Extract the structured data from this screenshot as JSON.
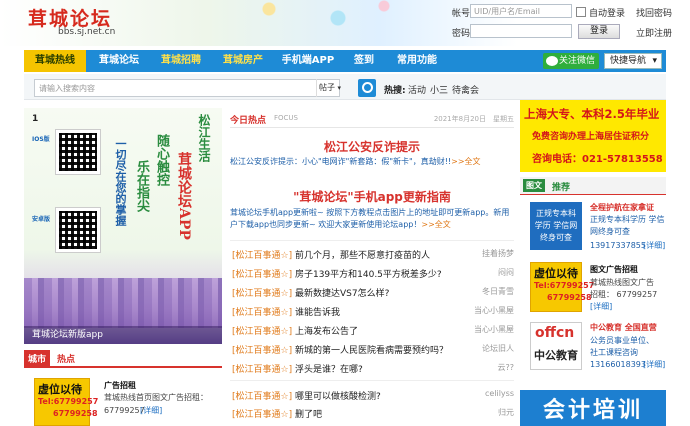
{
  "header": {
    "logo_text": "茸城论坛",
    "logo_url": "bbs.sj.net.cn",
    "login": {
      "account_label": "帐号",
      "account_placeholder": "UID/用户名/Email",
      "auto_login": "自动登录",
      "retrieve_password": "找回密码",
      "password_label": "密码",
      "login_button": "登录",
      "register": "立即注册"
    }
  },
  "nav": {
    "items": [
      "茸城热线",
      "茸城论坛",
      "茸城招聘",
      "茸城房产",
      "手机端APP",
      "签到",
      "常用功能"
    ],
    "wechat": "关注微信",
    "quicknav": "快捷导航"
  },
  "search": {
    "placeholder": "请输入搜索内容",
    "type": "帖子",
    "hot_label": "热搜:",
    "hot_links": [
      "活动",
      "小三",
      "待禽会"
    ]
  },
  "poster": {
    "number": "1",
    "ios_label": "IOS版",
    "android_label": "安卓版",
    "text_col1": "松江生活",
    "text_col2": "茸城论坛APP",
    "text_col3": "随心触控",
    "text_col4": "乐在指尖",
    "text_col5": "一切尽在您的掌握",
    "caption": "茸城论坛新版app"
  },
  "city": {
    "tag": "城市",
    "title": "热点",
    "ad_line1": "虚位以待",
    "ad_line2": "Tel:67799257",
    "ad_line3": "67799258",
    "ad_title": "广告招租",
    "ad_desc": "茸城热线首页图文广告招租：",
    "ad_phone": "67799257",
    "detail": "[详细]"
  },
  "middle": {
    "section_title": "今日热点",
    "section_en": "FOCUS",
    "date": "2021年8月20日",
    "weekday": "星期五",
    "headline1": "松江公安反诈提示",
    "blurb1": "松江公安反诈提示：小心\"电网诈\"新套路：假\"新卡\"，真劫财!!",
    "more1": ">>全文",
    "headline2": "\"茸城论坛\"手机app更新指南",
    "blurb2": "茸城论坛手机app更新啦~ 按照下方教程点击图片上的地址即可更新app。新用户下载app也同步更新~ 欢迎大家更新使用论坛app！",
    "more2": ">>全文",
    "news": [
      {
        "cat": "[松江百事通☆]",
        "title": "前几个月，那些不愿意打疫苗的人",
        "author": "挂着扬梦"
      },
      {
        "cat": "[松江百事通☆]",
        "title": "房子139平方和140.5平方税差多少?",
        "author": "闷闷"
      },
      {
        "cat": "[松江百事通☆]",
        "title": "最新数捷达VS7怎么样?",
        "author": "冬日青雪"
      },
      {
        "cat": "[松江百事通☆]",
        "title": "谁能告诉我",
        "author": "当心小黑屋"
      },
      {
        "cat": "[松江百事通☆]",
        "title": "上海发布公告了",
        "author": "当心小黑屋"
      },
      {
        "cat": "[松江百事通☆]",
        "title": "新城的第一人民医院看病需要预约吗？",
        "author": "论坛旧人"
      },
      {
        "cat": "[松江百事通☆]",
        "title": "浮头是谁？在哪?",
        "author": "云??"
      },
      {
        "cat": "[松江百事通☆]",
        "title": "哪里可以做核酸检测?",
        "author": "celilyss"
      },
      {
        "cat": "[松江百事通☆]",
        "title": "删了吧",
        "author": "归元"
      }
    ]
  },
  "right": {
    "banner_line1": "上海大专、本科2.5年毕业",
    "banner_line2": "免费咨询办理上海居住证积分",
    "banner_line3": "咨询电话：021-57813558",
    "section_tag": "图文",
    "section_title": "推荐",
    "items": [
      {
        "thumb": "正规专本科学历 学信网终身可查",
        "title": "全程护航在家拿证",
        "desc1": "正规专本科学历 学信网终身可查",
        "desc2": "13917337855",
        "detail": "[详细]"
      },
      {
        "thumb_line1": "虚位以待",
        "thumb_line2": "Tel:67799257",
        "thumb_line3": "67799258",
        "title": "图文广告招租",
        "desc1": "茸城热线图文广告",
        "desc2": "招租： 67799257",
        "detail": "[详细]"
      },
      {
        "thumb_line1": "offcn",
        "thumb_line2": "中公教育",
        "title": "中公教育 全国直营",
        "desc1": "公务员事业单位、",
        "desc2": "社工课程咨询",
        "desc3": "13166018393",
        "detail": "[详细]"
      }
    ],
    "bottom_banner": "会计培训"
  },
  "colors": {
    "nav_blue": "#1e8bd6",
    "nav_active": "#f5c400",
    "accent_red": "#d7322d",
    "accent_orange": "#e07a1a",
    "wechat_green": "#2fae3c"
  }
}
